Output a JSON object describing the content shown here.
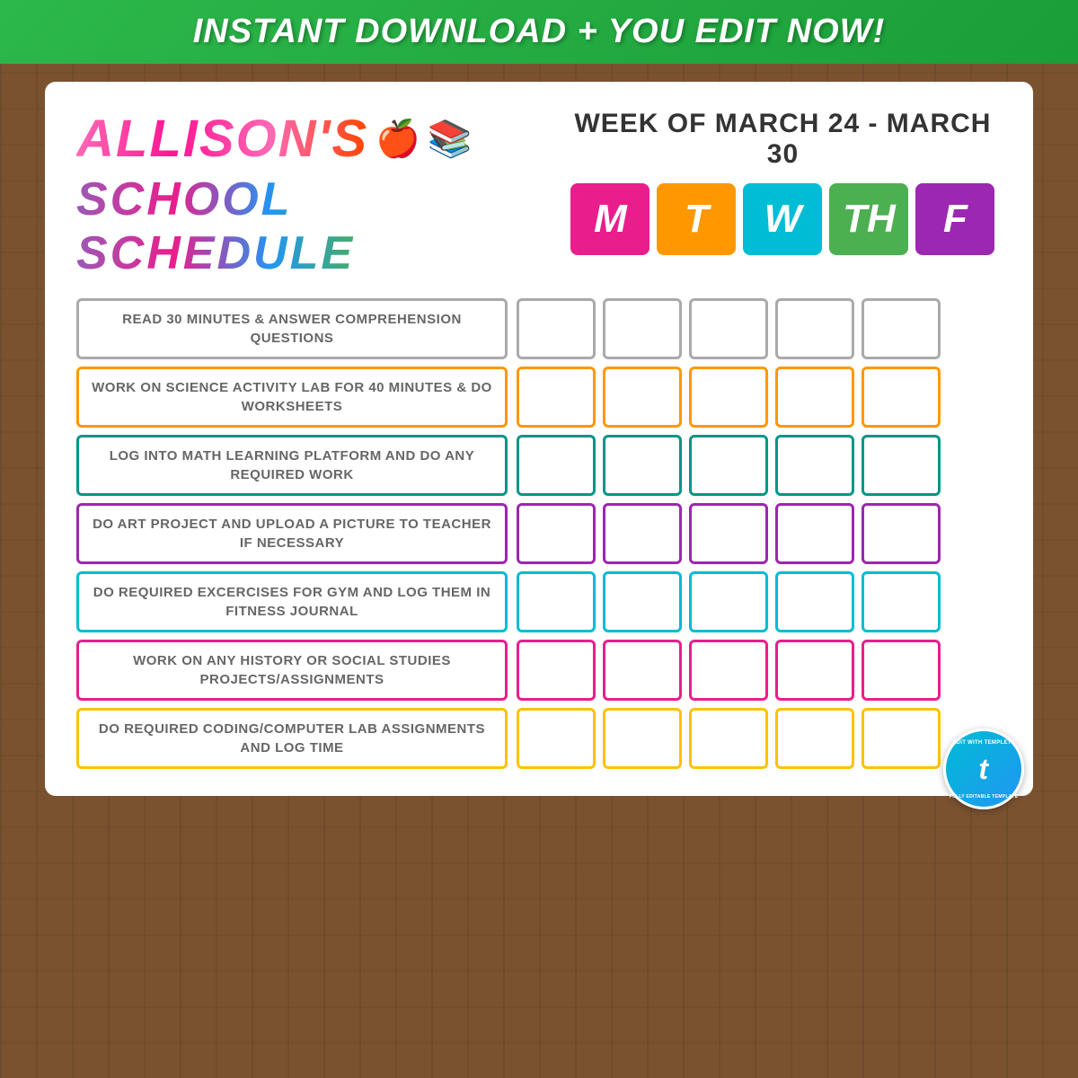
{
  "banner": {
    "text": "INSTANT DOWNLOAD + YOU EDIT NOW!"
  },
  "header": {
    "name": "ALLISON'S",
    "subtitle": "SCHOOL SCHEDULE",
    "week": "WEEK OF MARCH 24 - MARCH 30"
  },
  "days": [
    {
      "label": "M",
      "class": "day-m"
    },
    {
      "label": "T",
      "class": "day-t"
    },
    {
      "label": "W",
      "class": "day-w"
    },
    {
      "label": "TH",
      "class": "day-th"
    },
    {
      "label": "F",
      "class": "day-f"
    }
  ],
  "tasks": [
    {
      "text": "READ 30 MINUTES & ANSWER COMPREHENSION QUESTIONS",
      "colorClass": "row-gray"
    },
    {
      "text": "WORK ON SCIENCE ACTIVITY LAB FOR 40 MINUTES & DO WORKSHEETS",
      "colorClass": "row-orange"
    },
    {
      "text": "LOG INTO MATH LEARNING PLATFORM AND DO ANY REQUIRED WORK",
      "colorClass": "row-teal"
    },
    {
      "text": "DO ART PROJECT AND UPLOAD A PICTURE TO TEACHER IF NECESSARY",
      "colorClass": "row-purple"
    },
    {
      "text": "DO REQUIRED EXCERCISES FOR GYM AND LOG THEM IN FITNESS JOURNAL",
      "colorClass": "row-cyan"
    },
    {
      "text": "WORK ON ANY HISTORY OR SOCIAL STUDIES PROJECTS/ASSIGNMENTS",
      "colorClass": "row-pink"
    },
    {
      "text": "DO REQUIRED CODING/COMPUTER LAB ASSIGNMENTS AND LOG TIME",
      "colorClass": "row-gold"
    }
  ],
  "badge": {
    "topText": "EDIT WITH templett",
    "letter": "t",
    "bottomText": "FULLY EDITABLE TEMPLATE"
  }
}
